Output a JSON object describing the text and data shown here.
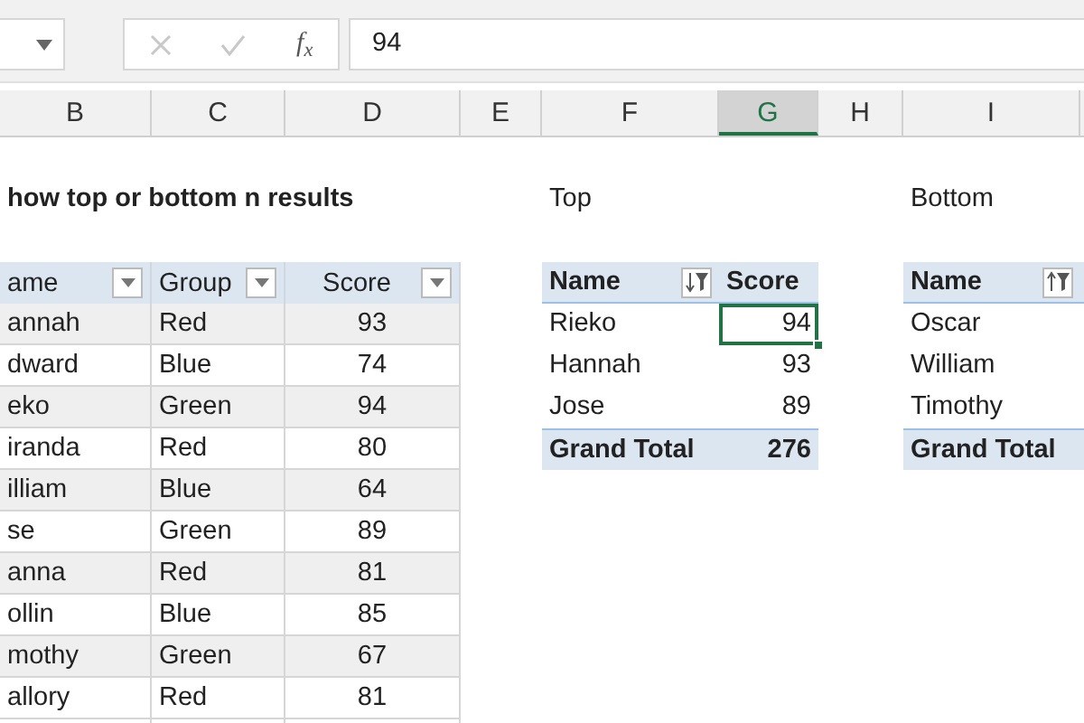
{
  "formula_bar": {
    "fx": "f$_{x}$",
    "value": "94"
  },
  "columns": [
    {
      "letter": "B",
      "selected": false
    },
    {
      "letter": "C",
      "selected": false
    },
    {
      "letter": "D",
      "selected": false
    },
    {
      "letter": "E",
      "selected": false
    },
    {
      "letter": "F",
      "selected": false
    },
    {
      "letter": "G",
      "selected": true
    },
    {
      "letter": "H",
      "selected": false
    },
    {
      "letter": "I",
      "selected": false
    }
  ],
  "title": "how top or bottom n results",
  "top_label": "Top",
  "bottom_label": "Bottom",
  "source_table": {
    "headers": [
      "ame",
      "Group",
      "Score"
    ],
    "rows": [
      {
        "name": "annah",
        "group": "Red",
        "score": "93"
      },
      {
        "name": "dward",
        "group": "Blue",
        "score": "74"
      },
      {
        "name": "eko",
        "group": "Green",
        "score": "94"
      },
      {
        "name": "iranda",
        "group": "Red",
        "score": "80"
      },
      {
        "name": "illiam",
        "group": "Blue",
        "score": "64"
      },
      {
        "name": "se",
        "group": "Green",
        "score": "89"
      },
      {
        "name": "anna",
        "group": "Red",
        "score": "81"
      },
      {
        "name": "ollin",
        "group": "Blue",
        "score": "85"
      },
      {
        "name": "mothy",
        "group": "Green",
        "score": "67"
      },
      {
        "name": "allory",
        "group": "Red",
        "score": "81"
      }
    ]
  },
  "top_pivot": {
    "headers": [
      "Name",
      "Score"
    ],
    "sort_descending": true,
    "rows": [
      {
        "name": "Rieko",
        "score": "94",
        "selected": true
      },
      {
        "name": "Hannah",
        "score": "93",
        "selected": false
      },
      {
        "name": "Jose",
        "score": "89",
        "selected": false
      }
    ],
    "total_label": "Grand Total",
    "total": "276"
  },
  "bottom_pivot": {
    "headers": [
      "Name"
    ],
    "sort_descending": false,
    "rows": [
      {
        "name": "Oscar"
      },
      {
        "name": "William"
      },
      {
        "name": "Timothy"
      }
    ],
    "total_label": "Grand Total"
  }
}
